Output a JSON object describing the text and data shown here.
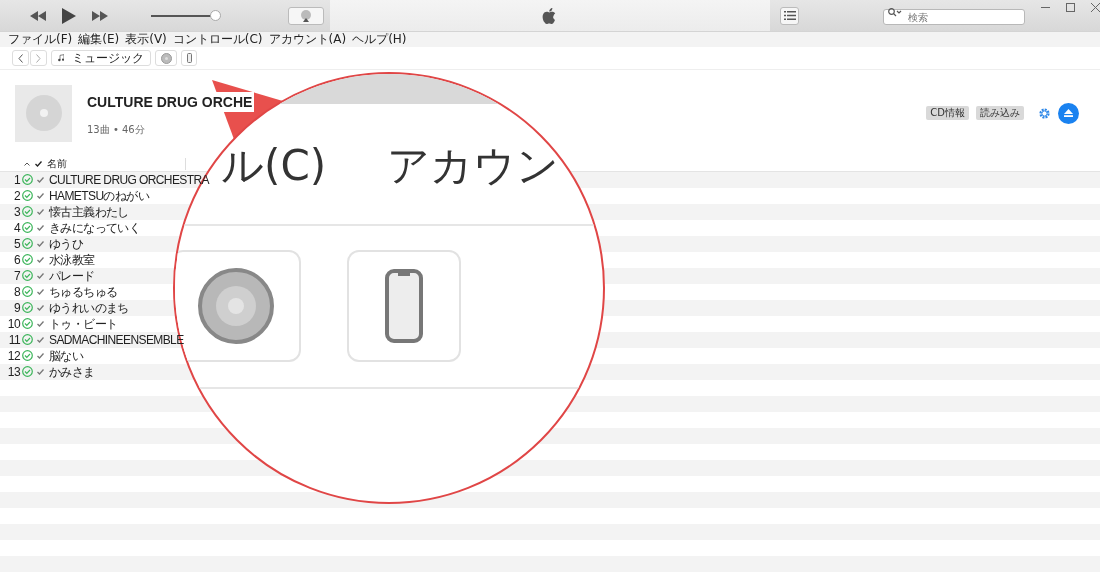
{
  "window": {
    "search_placeholder": "検索"
  },
  "player": {
    "volume": {
      "level": 0.92
    }
  },
  "menu": [
    "ファイル(F)",
    "編集(E)",
    "表示(V)",
    "コントロール(C)",
    "アカウント(A)",
    "ヘルプ(H)"
  ],
  "nav": {
    "library": "ミュージック"
  },
  "album": {
    "title": "CULTURE DRUG ORCHE",
    "summary": "13曲 • 46分",
    "buttons": [
      "CD情報",
      "読み込み"
    ]
  },
  "table": {
    "columns": [
      "名前"
    ],
    "rows": [
      {
        "number": "1",
        "title": "CULTURE DRUG ORCHESTRA",
        "imported": true,
        "checked": true
      },
      {
        "number": "2",
        "title": "HAMETSUのねがい",
        "imported": true,
        "checked": true
      },
      {
        "number": "3",
        "title": "懐古主義わたし",
        "imported": true,
        "checked": true
      },
      {
        "number": "4",
        "title": "きみになっていく",
        "imported": true,
        "checked": true
      },
      {
        "number": "5",
        "title": "ゆうひ",
        "imported": true,
        "checked": true
      },
      {
        "number": "6",
        "title": "水泳教室",
        "imported": true,
        "checked": true
      },
      {
        "number": "7",
        "title": "パレード",
        "imported": true,
        "checked": true
      },
      {
        "number": "8",
        "title": "ちゅるちゅる",
        "imported": true,
        "checked": true
      },
      {
        "number": "9",
        "title": "ゆうれいのまち",
        "imported": true,
        "checked": true
      },
      {
        "number": "10",
        "title": "トゥ・ビート",
        "imported": true,
        "checked": true
      },
      {
        "number": "11",
        "title": "SADMACHINEENSEMBLE",
        "imported": true,
        "checked": true
      },
      {
        "number": "12",
        "title": "脳ない",
        "imported": true,
        "checked": true
      },
      {
        "number": "13",
        "title": "かみさま",
        "imported": true,
        "checked": true
      }
    ]
  },
  "magnifier": {
    "menu_fragments": [
      "ル(C)",
      "アカウン"
    ]
  }
}
